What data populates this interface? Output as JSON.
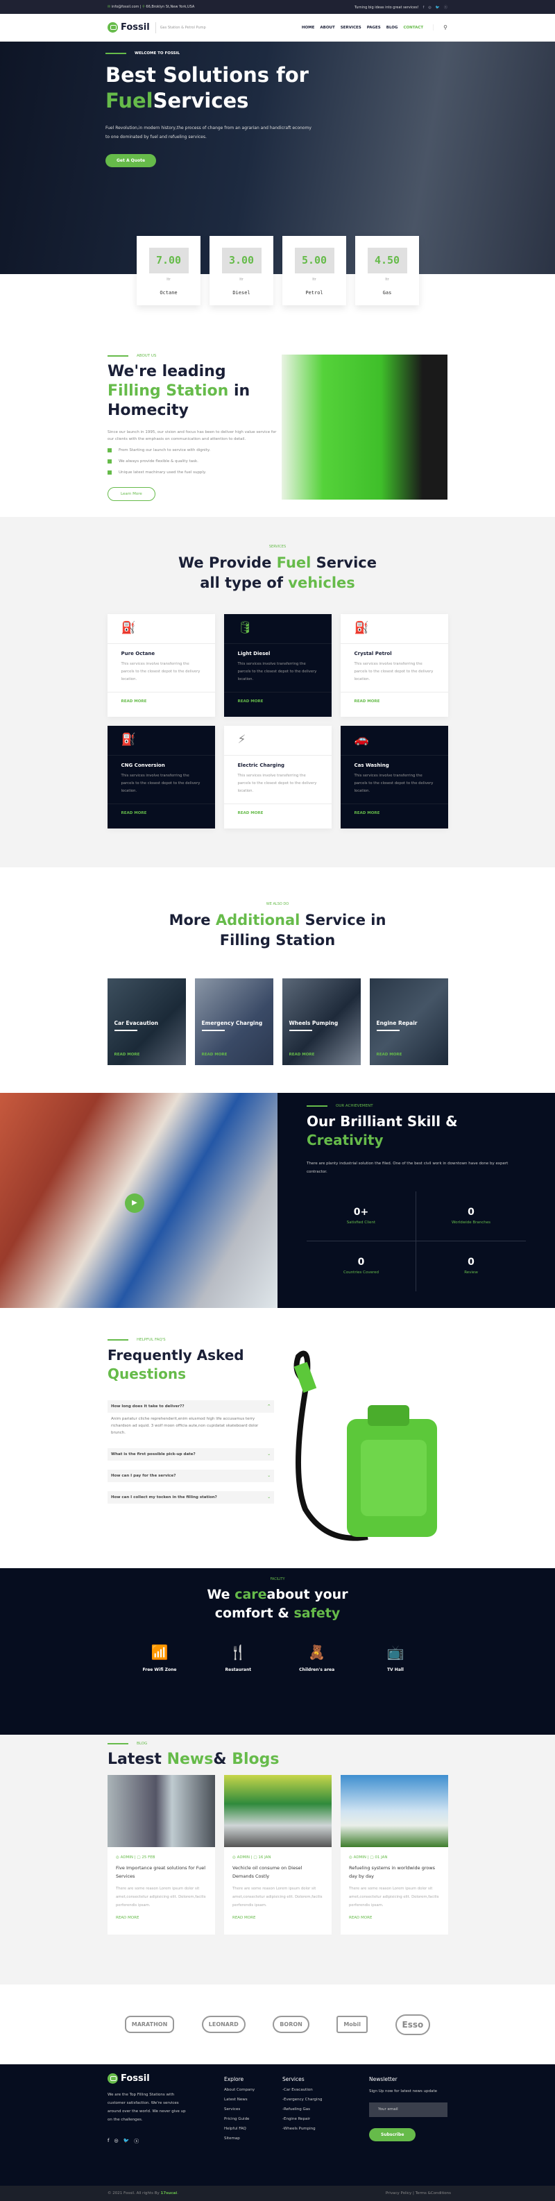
{
  "topbar": {
    "email": "info@fossil.com |",
    "address": "66,Broklyn St,New York,USA",
    "slogan": "Turning big ideas into great services!",
    "social": [
      "f",
      "◎",
      "🐦",
      "ⓢ"
    ]
  },
  "header": {
    "brand": "Fossil",
    "tagline": "Gas Station & Petrol Pump",
    "nav": [
      "HOME",
      "ABOUT",
      "SERVICES",
      "PAGES",
      "BLOG",
      "CONTACT"
    ],
    "active": "CONTACT"
  },
  "hero": {
    "eyebrow": "WELCOME TO FOSSIL",
    "title_line1": "Best Solutions for",
    "title_green": "Fuel",
    "title_rest": "Services",
    "text": "Fuel Revolution,in modern history,the process of change from an agrarian and handicraft economy to one dominated by fuel and refueling services.",
    "cta": "Get A Quote"
  },
  "prices": [
    {
      "value": "7.00",
      "unit": "ltr",
      "name": "Octane"
    },
    {
      "value": "3.00",
      "unit": "ltr",
      "name": "Diesel"
    },
    {
      "value": "5.00",
      "unit": "ltr",
      "name": "Petrol"
    },
    {
      "value": "4.50",
      "unit": "ltr",
      "name": "Gas"
    }
  ],
  "about": {
    "eyebrow": "ABOUT US",
    "t1": "We're leading ",
    "t2": "Filling Station",
    "t3": " in Homecity",
    "text": "Since our launch in 1995, our vision and focus has been to deliver high value service for our clients with the emphasis on communication and attention to detail.",
    "points": [
      "From Starting our launch to service with dignity.",
      "We always provide flexible & quality task.",
      "Unique latest machinary used the fuel supply."
    ],
    "cta": "Learn More"
  },
  "services": {
    "eyebrow": "SERVICES",
    "t1": "We Provide ",
    "t2": "Fuel",
    "t3": " Service",
    "t4": "all type of ",
    "t5": "vehicles",
    "read_more": "READ MORE",
    "items": [
      {
        "title": "Pure Octane",
        "text": "This services involve transferring the parcels to the closest depot to the delivery location.",
        "icon": "fuel-pump-icon"
      },
      {
        "title": "Light Diesel",
        "text": "This services involve transferring the parcels to the closest depot to the delivery location.",
        "icon": "jerrycan-icon"
      },
      {
        "title": "Crystal Petrol",
        "text": "This services involve transferring the parcels to the closest depot to the delivery location.",
        "icon": "petrol-can-icon"
      },
      {
        "title": "CNG Conversion",
        "text": "This services involve transferring the parcels to the closest depot to the delivery location.",
        "icon": "cng-station-icon"
      },
      {
        "title": "Electric Charging",
        "text": "This services involve transferring the parcels to the closest depot to the delivery location.",
        "icon": "charging-station-icon"
      },
      {
        "title": "Cas Washing",
        "text": "This services involve transferring the parcels to the closest depot to the delivery location.",
        "icon": "car-wash-icon"
      }
    ]
  },
  "additional": {
    "eyebrow": "WE ALSO DO",
    "t1": "More ",
    "t2": "Additional",
    "t3": " Service in",
    "t4": "Filling Station",
    "read_more": "READ MORE",
    "items": [
      "Car Evacaution",
      "Emergency Charging",
      "Wheels Pumping",
      "Engine Repair"
    ]
  },
  "achievement": {
    "eyebrow": "OUR ACHIEVEMENT",
    "t1": "Our Brilliant Skill &",
    "t2": "Creativity",
    "text": "There are planty industrial solution the filed. One of the best civil work in downtown have done by expert contractor.",
    "stats": [
      {
        "n": "0+",
        "l": "Satisfied Client"
      },
      {
        "n": "0",
        "l": "Worldwide Branches"
      },
      {
        "n": "0",
        "l": "Countries Covered"
      },
      {
        "n": "0",
        "l": "Review"
      }
    ]
  },
  "faq": {
    "eyebrow": "HELPFUL FAQ'S",
    "t1": "Frequently Asked",
    "t2": "Questions",
    "items": [
      {
        "q": "How long does it take to deliver??",
        "a": "Anim pariatur cliche reprehenderit,enim eiusmod high life accusamus terry richardson ad squid. 3 wolf moon officia aute,non cupidatat skateboard dolor brunch.",
        "open": true
      },
      {
        "q": "What is the first possible pick-up date?",
        "open": false
      },
      {
        "q": "How can I pay for the service?",
        "open": false
      },
      {
        "q": "How can I collect my tocken in the filling station?",
        "open": false
      }
    ]
  },
  "facility": {
    "eyebrow": "FACILITY",
    "t1": "We ",
    "t2": "care",
    "t3": "about your",
    "t4": "comfort & ",
    "t5": "safety",
    "items": [
      {
        "l": "Free Wifi Zone",
        "icon": "wifi-icon"
      },
      {
        "l": "Restaurant",
        "icon": "restaurant-icon"
      },
      {
        "l": "Children's area",
        "icon": "teddy-bear-icon"
      },
      {
        "l": "TV Hall",
        "icon": "tv-icon"
      }
    ]
  },
  "blog": {
    "eyebrow": "BLOG",
    "t1": "Latest ",
    "t2": "News",
    "t3": "& ",
    "t4": "Blogs",
    "read_more": "READ MORE",
    "posts": [
      {
        "author": "ADMIN |",
        "date": "25 FEB",
        "title": "Five Importance great solutions for Fuel Services",
        "text": "There are some reason Lorem ipsum dolor sit amet,consectetur adipisicing elit. Dolorem,facilis perferendis ipsam."
      },
      {
        "author": "ADMIN |",
        "date": "16 JAN",
        "title": "Vechicle oil consume on Diesel Demands Costly",
        "text": "There are some reason Lorem ipsum dolor sit amet,consectetur adipisicing elit. Dolorem,facilis perferendis ipsam."
      },
      {
        "author": "ADMIN |",
        "date": "01 JAN",
        "title": "Refueling systems in worldwide grows day by day",
        "text": "There are some reason Lorem ipsum dolor sit amet,consectetur adipisicing elit. Dolorem,facilis perferendis ipsam."
      }
    ]
  },
  "brands": [
    "MARATHON",
    "LEONARD",
    "BORON",
    "Mobil",
    "Esso"
  ],
  "footer": {
    "brand": "Fossil",
    "about": "We are the Top Filling Stations with customer satisfaction. We're services around over the world. We never give up on the challenges.",
    "explore_title": "Explore",
    "explore": [
      "About Company",
      "Latest News",
      "Services",
      "Pricing Guide",
      "Helpful FAQ",
      "Sitemap"
    ],
    "services_title": "Services",
    "services": [
      "-Car Evacaution",
      "-Evergency Charging",
      "-Refueling Gas",
      "-Engine Repair",
      "-Wheels Pumping"
    ],
    "newsletter_title": "Newsletter",
    "newsletter_text": "Sign Up now for latest news update",
    "email_placeholder": "Your email",
    "subscribe": "Subscribe",
    "copyright": "© 2021 Fossil. All rights By ",
    "by": "17sucai",
    "by_end": ".",
    "legal": "Privacy Policy | Terms &Conditions"
  },
  "colors": {
    "accent": "#66bb4a",
    "dark": "#060d1f",
    "topbar": "#1f2233"
  }
}
